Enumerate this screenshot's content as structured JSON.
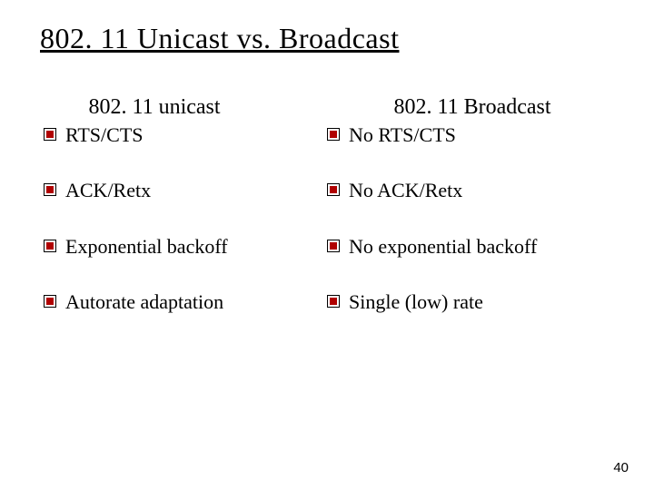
{
  "title": "802. 11 Unicast vs. Broadcast",
  "left": {
    "heading": "802. 11 unicast",
    "items": [
      "RTS/CTS",
      "ACK/Retx",
      "Exponential backoff",
      "Autorate adaptation"
    ]
  },
  "right": {
    "heading": "802. 11 Broadcast",
    "items": [
      "No RTS/CTS",
      "No ACK/Retx",
      "No exponential backoff",
      "Single (low) rate"
    ]
  },
  "page_number": "40"
}
